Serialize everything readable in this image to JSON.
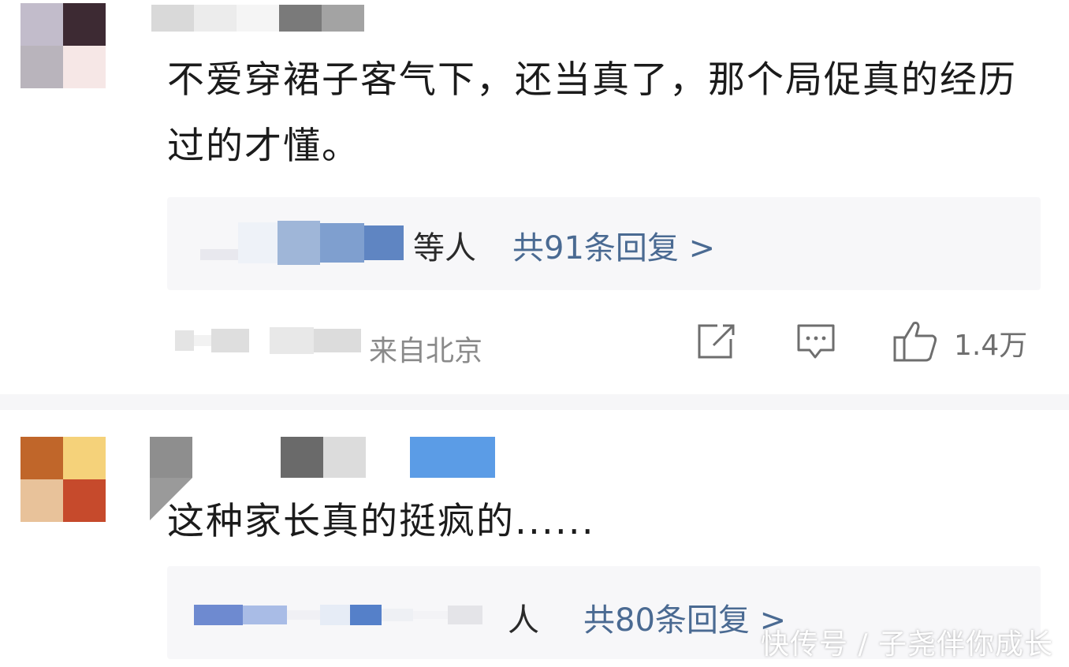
{
  "comments": [
    {
      "text": "不爱穿裙子客气下，还当真了，那个局促真的经历过的才懂。",
      "reply_suffix": "等人",
      "reply_count_label": "共91条回复 >",
      "location": "来自北京",
      "actions": {
        "share_icon": "share-icon",
        "comment_icon": "comment-icon",
        "like_icon": "thumbs-up-icon",
        "like_count": "1.4万"
      }
    },
    {
      "text": "这种家长真的挺疯的......",
      "reply_suffix": "人",
      "reply_count_label": "共80条回复 >"
    }
  ],
  "watermark": "快传号 / 子尧伴你成长",
  "colors": {
    "reply_link": "#4a6a92",
    "reply_box_bg": "#f7f7f9",
    "meta_text": "#8a8a8a"
  }
}
